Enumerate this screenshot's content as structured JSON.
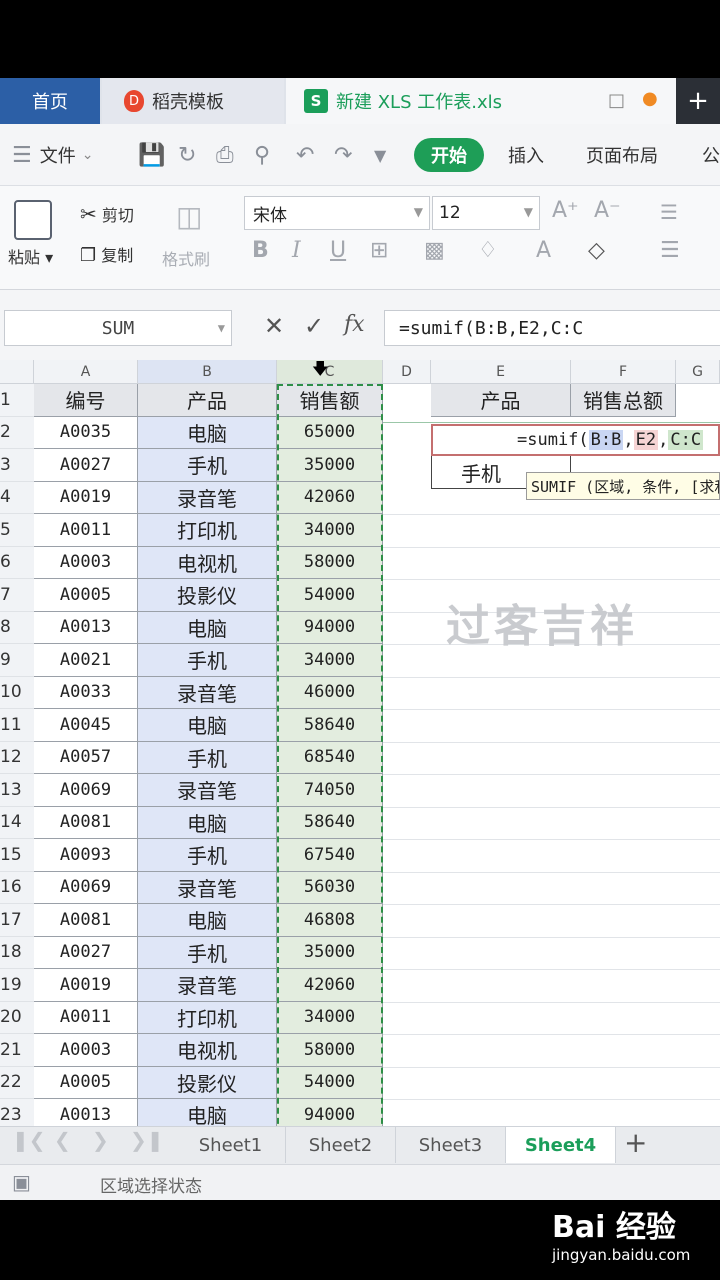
{
  "tabs": {
    "home": "首页",
    "template": "稻壳模板",
    "file": "新建 XLS 工作表.xls",
    "file_icon": "S",
    "template_icon": "D",
    "plus": "+"
  },
  "menu": {
    "file": "文件",
    "start": "开始",
    "insert": "插入",
    "page_layout": "页面布局",
    "more": "公"
  },
  "ribbon": {
    "paste": "粘贴",
    "cut": "剪切",
    "copy": "复制",
    "format_painter": "格式刷",
    "font_name": "宋体",
    "font_size": "12"
  },
  "formula_bar": {
    "name_box": "SUM",
    "formula": "=sumif(B:B,E2,C:C",
    "fx": "fx"
  },
  "grid": {
    "columns": [
      "A",
      "B",
      "C",
      "D",
      "E",
      "F",
      "G"
    ],
    "header_row": {
      "a": "编号",
      "b": "产品",
      "c": "销售额",
      "e": "产品",
      "f": "销售总额"
    },
    "rows": [
      {
        "n": "2",
        "a": "A0035",
        "b": "电脑",
        "c": "65000"
      },
      {
        "n": "3",
        "a": "A0027",
        "b": "手机",
        "c": "35000"
      },
      {
        "n": "4",
        "a": "A0019",
        "b": "录音笔",
        "c": "42060"
      },
      {
        "n": "5",
        "a": "A0011",
        "b": "打印机",
        "c": "34000"
      },
      {
        "n": "6",
        "a": "A0003",
        "b": "电视机",
        "c": "58000"
      },
      {
        "n": "7",
        "a": "A0005",
        "b": "投影仪",
        "c": "54000"
      },
      {
        "n": "8",
        "a": "A0013",
        "b": "电脑",
        "c": "94000"
      },
      {
        "n": "9",
        "a": "A0021",
        "b": "手机",
        "c": "34000"
      },
      {
        "n": "10",
        "a": "A0033",
        "b": "录音笔",
        "c": "46000"
      },
      {
        "n": "11",
        "a": "A0045",
        "b": "电脑",
        "c": "58640"
      },
      {
        "n": "12",
        "a": "A0057",
        "b": "手机",
        "c": "68540"
      },
      {
        "n": "13",
        "a": "A0069",
        "b": "录音笔",
        "c": "74050"
      },
      {
        "n": "14",
        "a": "A0081",
        "b": "电脑",
        "c": "58640"
      },
      {
        "n": "15",
        "a": "A0093",
        "b": "手机",
        "c": "67540"
      },
      {
        "n": "16",
        "a": "A0069",
        "b": "录音笔",
        "c": "56030"
      },
      {
        "n": "17",
        "a": "A0081",
        "b": "电脑",
        "c": "46808"
      },
      {
        "n": "18",
        "a": "A0027",
        "b": "手机",
        "c": "35000"
      },
      {
        "n": "19",
        "a": "A0019",
        "b": "录音笔",
        "c": "42060"
      },
      {
        "n": "20",
        "a": "A0011",
        "b": "打印机",
        "c": "34000"
      },
      {
        "n": "21",
        "a": "A0003",
        "b": "电视机",
        "c": "58000"
      },
      {
        "n": "22",
        "a": "A0005",
        "b": "投影仪",
        "c": "54000"
      },
      {
        "n": "23",
        "a": "A0013",
        "b": "电脑",
        "c": "94000"
      }
    ],
    "row1": "1",
    "e3": "手机",
    "editor": {
      "prefix": "=sumif(",
      "ref_b": "B:B",
      "sep1": ",",
      "ref_e": "E2",
      "sep2": ",",
      "ref_c": "C:C"
    },
    "tooltip": "SUMIF (区域, 条件, [求和区域])",
    "watermark": "过客吉祥"
  },
  "sheets": [
    "Sheet1",
    "Sheet2",
    "Sheet3",
    "Sheet4"
  ],
  "status": "区域选择状态",
  "brand": {
    "logo": "Bai 经验",
    "url": "jingyan.baidu.com"
  }
}
